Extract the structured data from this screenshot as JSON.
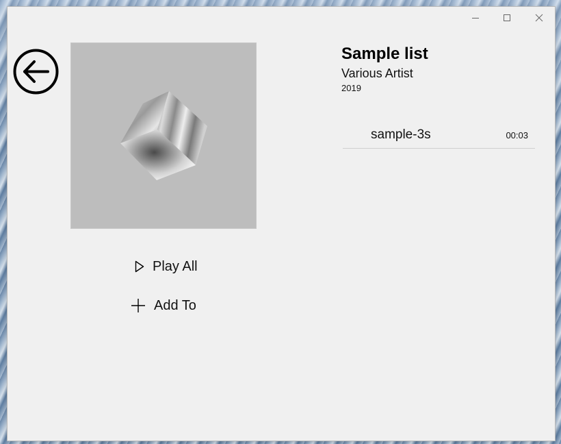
{
  "window": {
    "minimize_icon": "minimize-icon",
    "maximize_icon": "maximize-icon",
    "close_icon": "close-icon"
  },
  "nav": {
    "back_icon": "back-arrow-circle-icon"
  },
  "album": {
    "art_icon": "abstract-cube-artwork",
    "title": "Sample list",
    "artist": "Various Artist",
    "year": "2019"
  },
  "actions": {
    "play_all_label": "Play All",
    "play_all_icon": "play-outline-icon",
    "add_to_label": "Add To",
    "add_to_icon": "plus-icon"
  },
  "tracks": [
    {
      "name": "sample-3s",
      "duration": "00:03"
    }
  ],
  "colors": {
    "window_bg": "#f0f0f0",
    "art_bg": "#bdbdbd",
    "divider": "#cfcfcf"
  }
}
